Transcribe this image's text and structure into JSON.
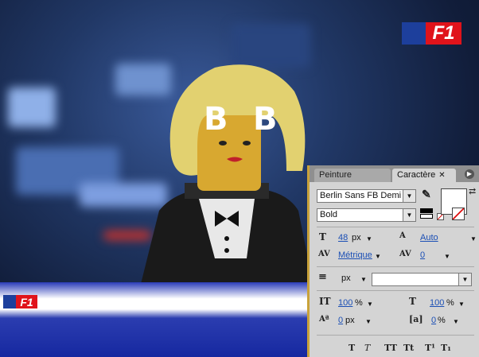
{
  "logos": {
    "text": "F1"
  },
  "overlay_letters": [
    "B",
    "B"
  ],
  "panel": {
    "tabs": [
      {
        "label": "Peinture",
        "active": false
      },
      {
        "label": "Caractère",
        "active": true
      }
    ],
    "close_symbol": "✕",
    "font_family": "Berlin Sans FB Demi",
    "font_style": "Bold",
    "font_size": {
      "value": "48",
      "unit": "px"
    },
    "leading": "Auto",
    "kerning": "Métrique",
    "tracking": "0",
    "line_unit": "px",
    "vertical_scale": {
      "value": "100",
      "unit": "%"
    },
    "horizontal_scale": {
      "value": "100",
      "unit": "%"
    },
    "baseline_shift": {
      "value": "0",
      "unit": "px"
    },
    "tsume": {
      "value": "0",
      "unit": "%"
    },
    "style_buttons": [
      "T",
      "T",
      "TT",
      "Tt",
      "T¹",
      "T₁"
    ],
    "colors": {
      "accent_border": "#c9a23a",
      "link": "#1b4fb5",
      "panel_bg": "#d4d4d4"
    }
  }
}
